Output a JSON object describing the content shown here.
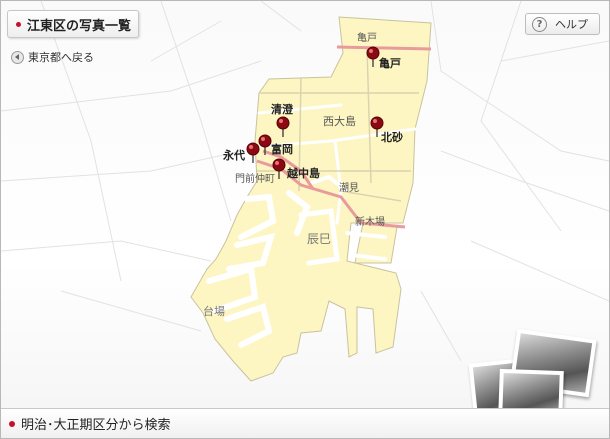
{
  "header": {
    "title": "江東区の写真一覧"
  },
  "nav": {
    "back_label": "東京都へ戻る",
    "help_label": "ヘルプ"
  },
  "map": {
    "place_labels": {
      "kameido_small": "亀戸",
      "nishiojima": "西大島",
      "monzen_nakacho": "門前仲町",
      "shiomi": "潮見",
      "shinkiba": "新木場",
      "tatsumi": "辰巳",
      "daiba": "台場"
    },
    "pins": [
      {
        "id": "kameido",
        "label": "亀戸"
      },
      {
        "id": "kiyosumi",
        "label": "清澄"
      },
      {
        "id": "kitasuna",
        "label": "北砂"
      },
      {
        "id": "tomioka",
        "label": "富岡"
      },
      {
        "id": "nagai",
        "label": "永代"
      },
      {
        "id": "etchujima",
        "label": "越中島"
      }
    ],
    "colors": {
      "land": "#fdf6c3",
      "water": "#ffffff",
      "rail": "#e99a9a",
      "pin": "#8b0a12"
    }
  },
  "footer": {
    "search_label": "明治･大正期区分から検索"
  }
}
